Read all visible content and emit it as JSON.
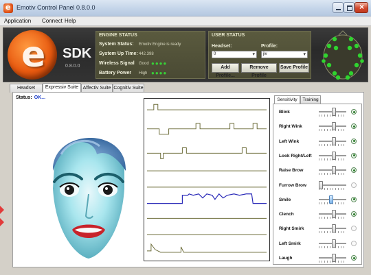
{
  "window": {
    "title": "Emotiv Control Panel 0.8.0.0"
  },
  "menu": [
    "Application",
    "Connect",
    "Help"
  ],
  "banner": {
    "sdk_label": "SDK",
    "version": "0.8.0.0",
    "engine_status": {
      "title": "ENGINE STATUS",
      "rows": [
        {
          "label": "System Status:",
          "value": "Emotiv Engine is ready"
        },
        {
          "label": "System Up Time:",
          "value": "442.398"
        },
        {
          "label": "Wireless Signal",
          "value": "Good",
          "dots": "●●●●"
        },
        {
          "label": "Battery Power",
          "value": "High",
          "dots": "●●●●"
        }
      ],
      "dot_color": "#38d038"
    },
    "user_status": {
      "title": "USER STATUS",
      "headset_label": "Headset:",
      "profile_label": "Profile:",
      "headset_value": "0",
      "profile_value": "jiv",
      "buttons": [
        "Add Profile...",
        "Remove Profile",
        "Save Profile"
      ]
    }
  },
  "tabs": [
    "Headset Setup",
    "Expressiv Suite",
    "Affectiv Suite",
    "Cognitiv Suite"
  ],
  "active_tab": 1,
  "status": {
    "label": "Status:",
    "value": "OK..."
  },
  "sensitivity": {
    "tabs": [
      "Sensitivity",
      "Training"
    ],
    "rows": [
      {
        "label": "Blink",
        "level": 0.55,
        "indicator": "on"
      },
      {
        "label": "Right Wink",
        "level": 0.55,
        "indicator": "on"
      },
      {
        "label": "Left Wink",
        "level": 0.55,
        "indicator": "on"
      },
      {
        "label": "Look Right/Left",
        "level": 0.55,
        "indicator": "on"
      },
      {
        "label": "Raise Brow",
        "level": 0.55,
        "indicator": "on"
      },
      {
        "label": "Furrow Brow",
        "level": 0.0,
        "indicator": "off"
      },
      {
        "label": "Smile",
        "level": 0.45,
        "indicator": "on"
      },
      {
        "label": "Clench",
        "level": 0.55,
        "indicator": "on"
      },
      {
        "label": "Right Smirk",
        "level": 0.55,
        "indicator": "off"
      },
      {
        "label": "Left Smirk",
        "level": 0.55,
        "indicator": "off"
      },
      {
        "label": "Laugh",
        "level": 0.55,
        "indicator": "on"
      }
    ]
  },
  "colors": {
    "accent": "#1a3cc8",
    "trace": "#6b6b38",
    "active_trace": "#2a2ab8"
  }
}
